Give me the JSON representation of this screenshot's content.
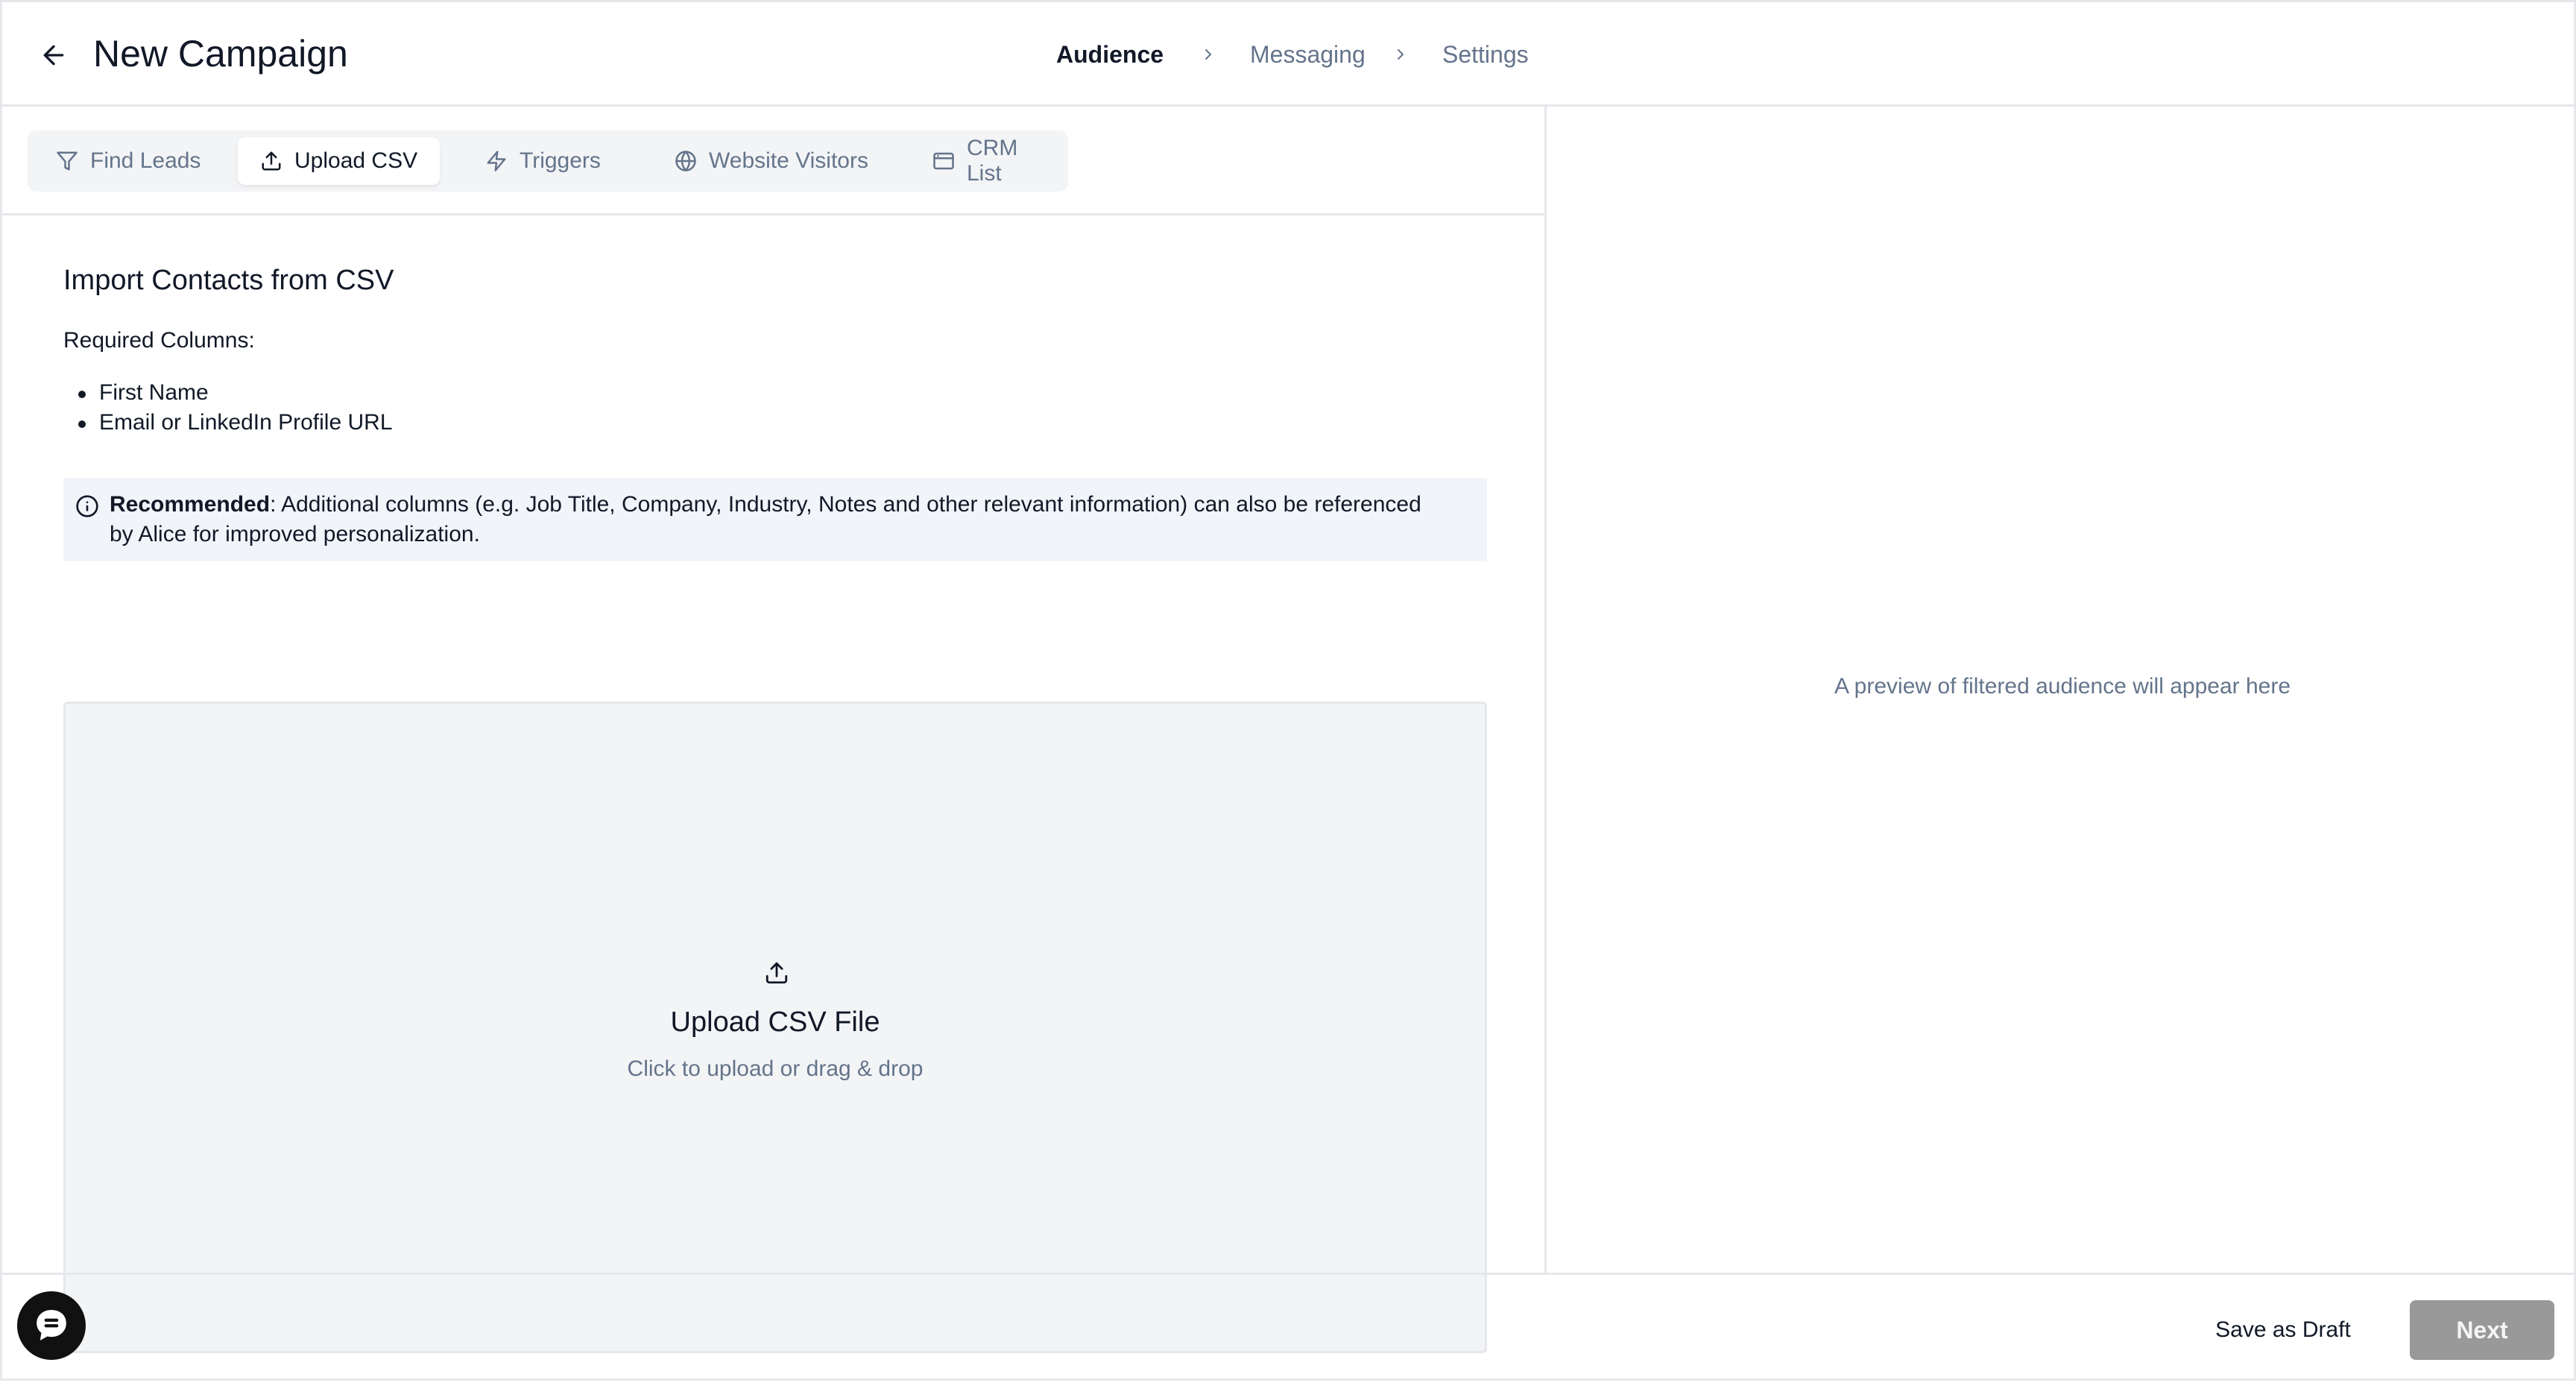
{
  "header": {
    "title": "New Campaign",
    "steps": [
      {
        "label": "Audience",
        "active": true
      },
      {
        "label": "Messaging",
        "active": false
      },
      {
        "label": "Settings",
        "active": false
      }
    ]
  },
  "tabs": [
    {
      "label": "Find Leads",
      "icon": "filter-icon",
      "selected": false
    },
    {
      "label": "Upload CSV",
      "icon": "upload-icon",
      "selected": true
    },
    {
      "label": "Triggers",
      "icon": "lightning-icon",
      "selected": false
    },
    {
      "label": "Website Visitors",
      "icon": "globe-icon",
      "selected": false
    },
    {
      "label": "CRM List",
      "icon": "crm-card-icon",
      "selected": false
    }
  ],
  "import": {
    "title": "Import Contacts from CSV",
    "required_label": "Required Columns:",
    "required_columns": [
      "First Name",
      "Email or LinkedIn Profile URL"
    ],
    "info": {
      "bold": "Recommended",
      "text": ": Additional columns (e.g. Job Title, Company, Industry, Notes and other relevant information) can also be referenced by Alice for improved personalization."
    },
    "dropzone": {
      "title": "Upload CSV File",
      "subtitle": "Click to upload or drag & drop"
    }
  },
  "preview": {
    "placeholder": "A preview of filtered audience will appear here"
  },
  "footer": {
    "save_draft_label": "Save as Draft",
    "next_label": "Next"
  },
  "colors": {
    "border": "#e5e7eb",
    "muted_text": "#64748b",
    "tab_bg": "#f3f4f6",
    "info_bg": "#f1f5f9",
    "next_disabled": "#999999"
  }
}
